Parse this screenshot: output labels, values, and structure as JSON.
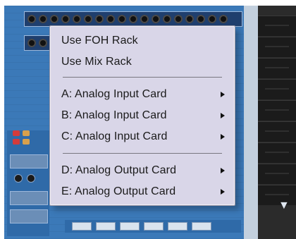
{
  "menu": {
    "items": [
      {
        "label": "Use FOH Rack",
        "has_submenu": false
      },
      {
        "label": "Use Mix Rack",
        "has_submenu": false
      },
      {
        "label": "A: Analog Input Card",
        "has_submenu": true
      },
      {
        "label": "B: Analog Input Card",
        "has_submenu": true
      },
      {
        "label": "C: Analog Input Card",
        "has_submenu": true
      },
      {
        "label": "D: Analog Output Card",
        "has_submenu": true
      },
      {
        "label": "E: Analog Output Card",
        "has_submenu": true
      }
    ],
    "icons": {
      "submenu": "submenu-arrow-icon",
      "console_arrow": "down-triangle-icon"
    }
  },
  "background": {
    "colors": {
      "console_blue": "#3b79b8",
      "menu_bg": "#d9d6e8",
      "dark_strip": "#2b2b2b"
    },
    "console_arrow_glyph": "▼"
  }
}
